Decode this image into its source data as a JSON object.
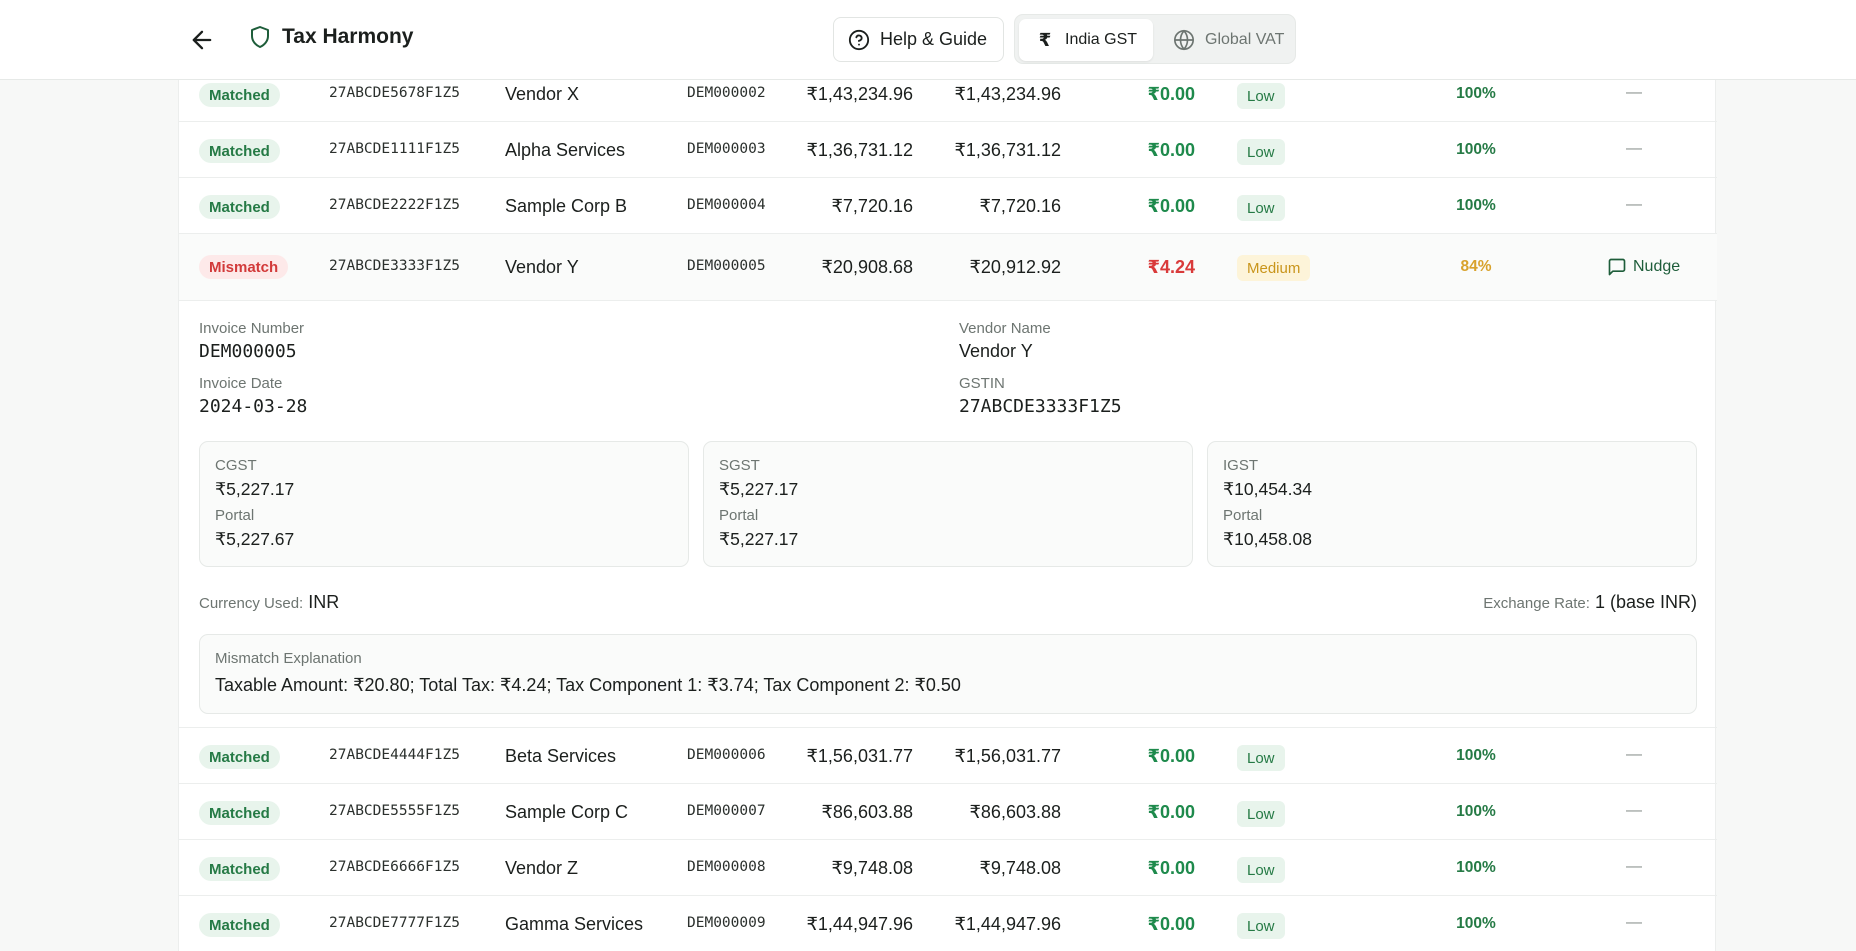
{
  "header": {
    "title": "Tax Harmony",
    "help_label": "Help & Guide",
    "regions": [
      {
        "label": "India GST",
        "icon": "rupee-icon",
        "active": true
      },
      {
        "label": "Global VAT",
        "icon": "globe-icon",
        "active": false
      }
    ]
  },
  "rows_top": [
    {
      "status": "Matched",
      "gstin": "27ABCDE5678F1Z5",
      "vendor": "Vendor X",
      "invoice": "DEM000002",
      "amount_books": "₹1,43,234.96",
      "amount_portal": "₹1,43,234.96",
      "difference": "₹0.00",
      "risk": "Low",
      "score": "100%",
      "action": "—"
    },
    {
      "status": "Matched",
      "gstin": "27ABCDE1111F1Z5",
      "vendor": "Alpha Services",
      "invoice": "DEM000003",
      "amount_books": "₹1,36,731.12",
      "amount_portal": "₹1,36,731.12",
      "difference": "₹0.00",
      "risk": "Low",
      "score": "100%",
      "action": "—"
    },
    {
      "status": "Matched",
      "gstin": "27ABCDE2222F1Z5",
      "vendor": "Sample Corp B",
      "invoice": "DEM000004",
      "amount_books": "₹7,720.16",
      "amount_portal": "₹7,720.16",
      "difference": "₹0.00",
      "risk": "Low",
      "score": "100%",
      "action": "—"
    }
  ],
  "mismatch_row": {
    "status": "Mismatch",
    "gstin": "27ABCDE3333F1Z5",
    "vendor": "Vendor Y",
    "invoice": "DEM000005",
    "amount_books": "₹20,908.68",
    "amount_portal": "₹20,912.92",
    "difference": "₹4.24",
    "risk": "Medium",
    "score": "84%",
    "action": "Nudge"
  },
  "detail": {
    "invoice_number_label": "Invoice Number",
    "invoice_number": "DEM000005",
    "invoice_date_label": "Invoice Date",
    "invoice_date": "2024-03-28",
    "vendor_name_label": "Vendor Name",
    "vendor_name": "Vendor Y",
    "gstin_label": "GSTIN",
    "gstin": "27ABCDE3333F1Z5",
    "portal_label": "Portal",
    "cgst": {
      "label": "CGST",
      "value": "₹5,227.17",
      "portal": "₹5,227.67"
    },
    "sgst": {
      "label": "SGST",
      "value": "₹5,227.17",
      "portal": "₹5,227.17"
    },
    "igst": {
      "label": "IGST",
      "value": "₹10,454.34",
      "portal": "₹10,458.08"
    },
    "currency_label": "Currency Used:",
    "currency": "INR",
    "exchange_label": "Exchange Rate:",
    "exchange": "1 (base INR)",
    "explanation_label": "Mismatch Explanation",
    "explanation": "Taxable Amount: ₹20.80; Total Tax: ₹4.24; Tax Component 1: ₹3.74; Tax Component 2: ₹0.50"
  },
  "rows_bottom": [
    {
      "status": "Matched",
      "gstin": "27ABCDE4444F1Z5",
      "vendor": "Beta Services",
      "invoice": "DEM000006",
      "amount_books": "₹1,56,031.77",
      "amount_portal": "₹1,56,031.77",
      "difference": "₹0.00",
      "risk": "Low",
      "score": "100%",
      "action": "—"
    },
    {
      "status": "Matched",
      "gstin": "27ABCDE5555F1Z5",
      "vendor": "Sample Corp C",
      "invoice": "DEM000007",
      "amount_books": "₹86,603.88",
      "amount_portal": "₹86,603.88",
      "difference": "₹0.00",
      "risk": "Low",
      "score": "100%",
      "action": "—"
    },
    {
      "status": "Matched",
      "gstin": "27ABCDE6666F1Z5",
      "vendor": "Vendor Z",
      "invoice": "DEM000008",
      "amount_books": "₹9,748.08",
      "amount_portal": "₹9,748.08",
      "difference": "₹0.00",
      "risk": "Low",
      "score": "100%",
      "action": "—"
    },
    {
      "status": "Matched",
      "gstin": "27ABCDE7777F1Z5",
      "vendor": "Gamma Services",
      "invoice": "DEM000009",
      "amount_books": "₹1,44,947.96",
      "amount_portal": "₹1,44,947.96",
      "difference": "₹0.00",
      "risk": "Low",
      "score": "100%",
      "action": "—"
    }
  ]
}
